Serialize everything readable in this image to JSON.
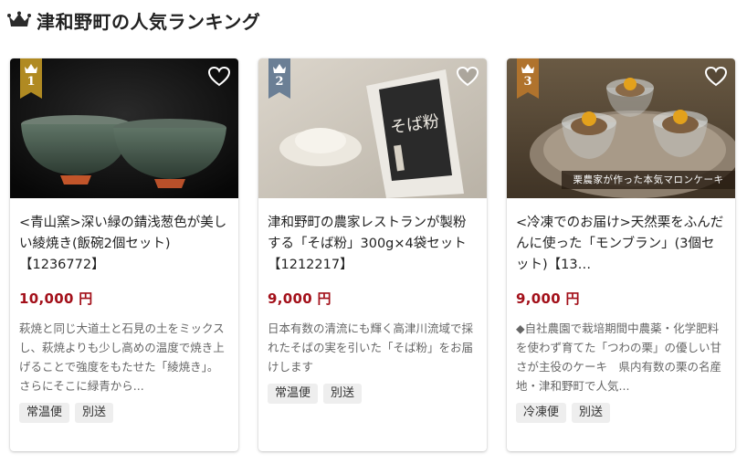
{
  "header": {
    "title": "津和野町の人気ランキング"
  },
  "colors": {
    "gold": "#b08a22",
    "silver": "#6b7f95",
    "bronze": "#b0732d",
    "price": "#a3101a"
  },
  "items": [
    {
      "rank": "1",
      "title": "<青山窯>深い緑の錆浅葱色が美しい綾焼き(飯碗2個セット)【1236772】",
      "price": "10,000 円",
      "description": "萩焼と同じ大道土と石見の土をミックスし、萩焼よりも少し高めの温度で焼き上げることで強度をもたせた「綾焼き」。さらにそこに緑青から...",
      "tags": [
        "常温便",
        "別送"
      ]
    },
    {
      "rank": "2",
      "title": "津和野町の農家レストランが製粉する「そば粉」300g×4袋セット【1212217】",
      "price": "9,000 円",
      "description": "日本有数の清流にも輝く高津川流域で採れたそばの実を引いた「そば粉」をお届けします",
      "tags": [
        "常温便",
        "別送"
      ]
    },
    {
      "rank": "3",
      "title": "<冷凍でのお届け>天然栗をふんだんに使った「モンブラン」(3個セット)【13…",
      "price": "9,000 円",
      "description": "◆自社農園で栽培期間中農薬・化学肥料を使わず育てた「つわの栗」の優しい甘さが主役のケーキ　県内有数の栗の名産地・津和野町で人気...",
      "tags": [
        "冷凍便",
        "別送"
      ],
      "image_caption": "栗農家が作った本気マロンケーキ"
    }
  ]
}
